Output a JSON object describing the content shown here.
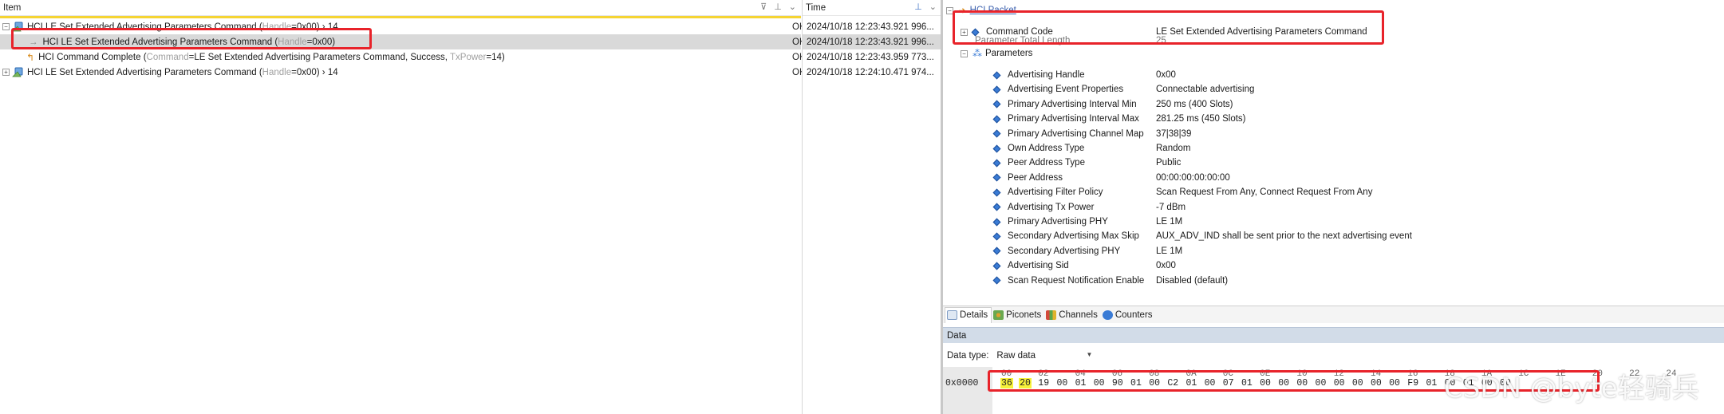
{
  "packet_list": {
    "column_item": "Item",
    "column_time": "Time",
    "rows": [
      {
        "pre": "HCI LE Set Extended Advertising Parameters Command (",
        "grey1": "Handle",
        "mid": "=0x00) › 14",
        "post": "",
        "grey2": "",
        "end": "",
        "status": "OK",
        "time": "2024/10/18 12:23:43.921 996..."
      },
      {
        "pre": "HCI LE Set Extended Advertising Parameters Command (",
        "grey1": "Handle",
        "mid": "=0x00)",
        "post": "",
        "grey2": "",
        "end": "",
        "status": "OK",
        "time": "2024/10/18 12:23:43.921 996..."
      },
      {
        "pre": "HCI Command Complete (",
        "grey1": "Command",
        "mid": "=LE Set Extended Advertising Parameters Command, Success, ",
        "post": "",
        "grey2": "TxPower",
        "end": "=14)",
        "status": "OK",
        "time": "2024/10/18 12:23:43.959 773..."
      },
      {
        "pre": "HCI LE Set Extended Advertising Parameters Command (",
        "grey1": "Handle",
        "mid": "=0x00) › 14",
        "post": "",
        "grey2": "",
        "end": "",
        "status": "OK",
        "time": "2024/10/18 12:24:10.471 974..."
      }
    ]
  },
  "details": {
    "root_label": "HCI Packet",
    "command_code_label": "Command Code",
    "command_code_value": "LE Set Extended Advertising Parameters Command",
    "param_total_length_label": "Parameter Total Length",
    "param_total_length_value": "25",
    "parameters_label": "Parameters",
    "params": [
      {
        "name": "Advertising Handle",
        "value": "0x00"
      },
      {
        "name": "Advertising Event Properties",
        "value": "Connectable advertising"
      },
      {
        "name": "Primary Advertising Interval Min",
        "value": "250 ms (400 Slots)"
      },
      {
        "name": "Primary Advertising Interval Max",
        "value": "281.25 ms (450 Slots)"
      },
      {
        "name": "Primary Advertising Channel Map",
        "value": "37|38|39"
      },
      {
        "name": "Own Address Type",
        "value": "Random"
      },
      {
        "name": "Peer Address Type",
        "value": "Public"
      },
      {
        "name": "Peer Address",
        "value": "00:00:00:00:00:00"
      },
      {
        "name": "Advertising Filter Policy",
        "value": "Scan Request From Any, Connect Request From Any"
      },
      {
        "name": "Advertising Tx Power",
        "value": "-7 dBm"
      },
      {
        "name": "Primary Advertising PHY",
        "value": "LE 1M"
      },
      {
        "name": "Secondary Advertising Max Skip",
        "value": "AUX_ADV_IND shall be sent prior to the next advertising event"
      },
      {
        "name": "Secondary Advertising PHY",
        "value": "LE 1M"
      },
      {
        "name": "Advertising Sid",
        "value": "0x00"
      },
      {
        "name": "Scan Request Notification Enable",
        "value": "Disabled (default)"
      }
    ]
  },
  "tabs": [
    {
      "label": "Details",
      "icon": "details-icon",
      "active": true
    },
    {
      "label": "Piconets",
      "icon": "piconets-icon",
      "active": false
    },
    {
      "label": "Channels",
      "icon": "channels-icon",
      "active": false
    },
    {
      "label": "Counters",
      "icon": "counters-icon",
      "active": false
    }
  ],
  "data_panel": {
    "title": "Data",
    "data_type_label": "Data type:",
    "data_type_value": "Raw data",
    "offset_label": "0x0000",
    "offsets": [
      "00",
      "02",
      "04",
      "06",
      "08",
      "0A",
      "0C",
      "0E",
      "10",
      "12",
      "14",
      "16",
      "18",
      "1A",
      "1C",
      "1E",
      "20",
      "22",
      "24"
    ],
    "bytes": [
      "36",
      "20",
      "19",
      "00",
      "01",
      "00",
      "90",
      "01",
      "00",
      "C2",
      "01",
      "00",
      "07",
      "01",
      "00",
      "00",
      "00",
      "00",
      "00",
      "00",
      "00",
      "00",
      "F9",
      "01",
      "00",
      "01",
      "00",
      "00"
    ],
    "highlighted_bytes": 2
  },
  "watermark": "CSDN @byte轻骑兵",
  "colors": {
    "highlight_red": "#e8232a",
    "accent_yellow": "#f5d433",
    "byte_highlight": "#f7f23a",
    "data_header": "#d2dce8"
  }
}
